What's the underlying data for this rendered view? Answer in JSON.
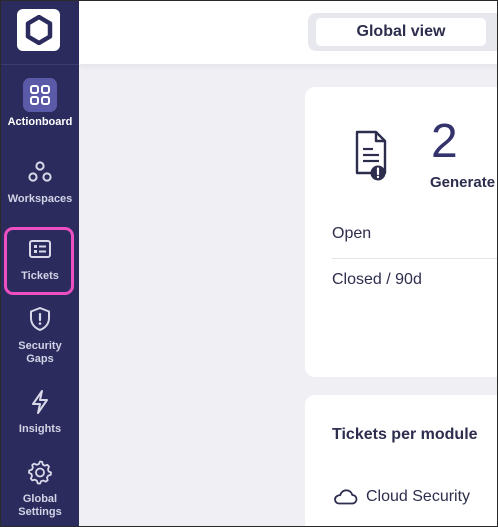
{
  "sidebar": {
    "items": [
      {
        "label": "Actionboard",
        "icon": "grid-icon"
      },
      {
        "label": "Workspaces",
        "icon": "workspaces-icon"
      },
      {
        "label": "Tickets",
        "icon": "tickets-icon"
      },
      {
        "label": "Security\nGaps",
        "icon": "shield-alert-icon"
      },
      {
        "label": "Insights",
        "icon": "lightning-icon"
      },
      {
        "label": "Global\nSettings",
        "icon": "gear-icon"
      }
    ]
  },
  "header": {
    "view_label": "Global view"
  },
  "summary_card": {
    "count": "2",
    "count_label": "Generate",
    "rows": [
      "Open",
      "Closed / 90d"
    ]
  },
  "module_card": {
    "title": "Tickets per module",
    "modules": [
      {
        "label": "Cloud Security",
        "icon": "cloud-icon"
      }
    ]
  },
  "colors": {
    "sidebar_bg": "#2b2b5e",
    "active_item_bg": "#5b5aa8",
    "highlight": "#ee4fc2",
    "text_dark": "#2d2d4e"
  }
}
